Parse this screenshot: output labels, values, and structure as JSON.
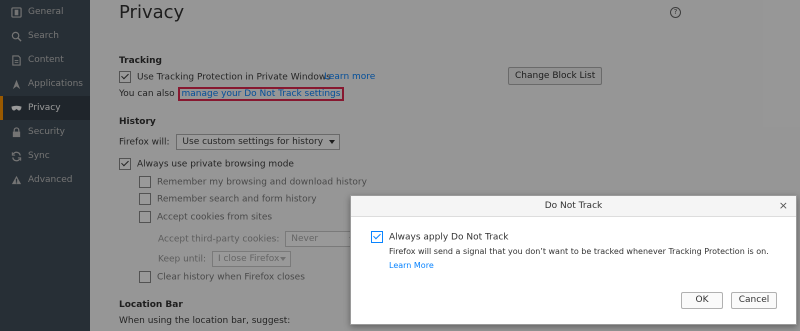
{
  "sidebar": {
    "items": [
      {
        "label": "General",
        "icon": "general-icon",
        "active": false
      },
      {
        "label": "Search",
        "icon": "search-icon",
        "active": false
      },
      {
        "label": "Content",
        "icon": "content-icon",
        "active": false
      },
      {
        "label": "Applications",
        "icon": "applications-icon",
        "active": false
      },
      {
        "label": "Privacy",
        "icon": "privacy-mask-icon",
        "active": true
      },
      {
        "label": "Security",
        "icon": "security-icon",
        "active": false
      },
      {
        "label": "Sync",
        "icon": "sync-icon",
        "active": false
      },
      {
        "label": "Advanced",
        "icon": "advanced-icon",
        "active": false
      }
    ]
  },
  "page": {
    "title": "Privacy",
    "help_icon": "?"
  },
  "tracking": {
    "heading": "Tracking",
    "use_protection_label": "Use Tracking Protection in Private Windows",
    "learn_more": "Learn more",
    "change_block_list": "Change Block List",
    "also_prefix": "You can also",
    "dnt_link": "manage your Do Not Track settings"
  },
  "history": {
    "heading": "History",
    "firefox_will_label": "Firefox will:",
    "firefox_will_value": "Use custom settings for history",
    "private_mode_label": "Always use private browsing mode",
    "remember_browsing": "Remember my browsing and download history",
    "remember_search": "Remember search and form history",
    "accept_cookies": "Accept cookies from sites",
    "third_party_label": "Accept third-party cookies:",
    "third_party_value": "Never",
    "keep_until_label": "Keep until:",
    "keep_until_value": "I close Firefox",
    "clear_history": "Clear history when Firefox closes"
  },
  "location_bar": {
    "heading": "Location Bar",
    "suggest_text": "When using the location bar, suggest:"
  },
  "dialog": {
    "title": "Do Not Track",
    "close_icon": "×",
    "always_apply": "Always apply Do Not Track",
    "description": "Firefox will send a signal that you don’t want to be tracked whenever Tracking Protection is on.",
    "learn_more": "Learn More",
    "ok": "OK",
    "cancel": "Cancel"
  },
  "colors": {
    "sidebar": "#424f5a",
    "accent": "#ff9500",
    "link": "#0a84ff",
    "highlight": "#e22850"
  }
}
